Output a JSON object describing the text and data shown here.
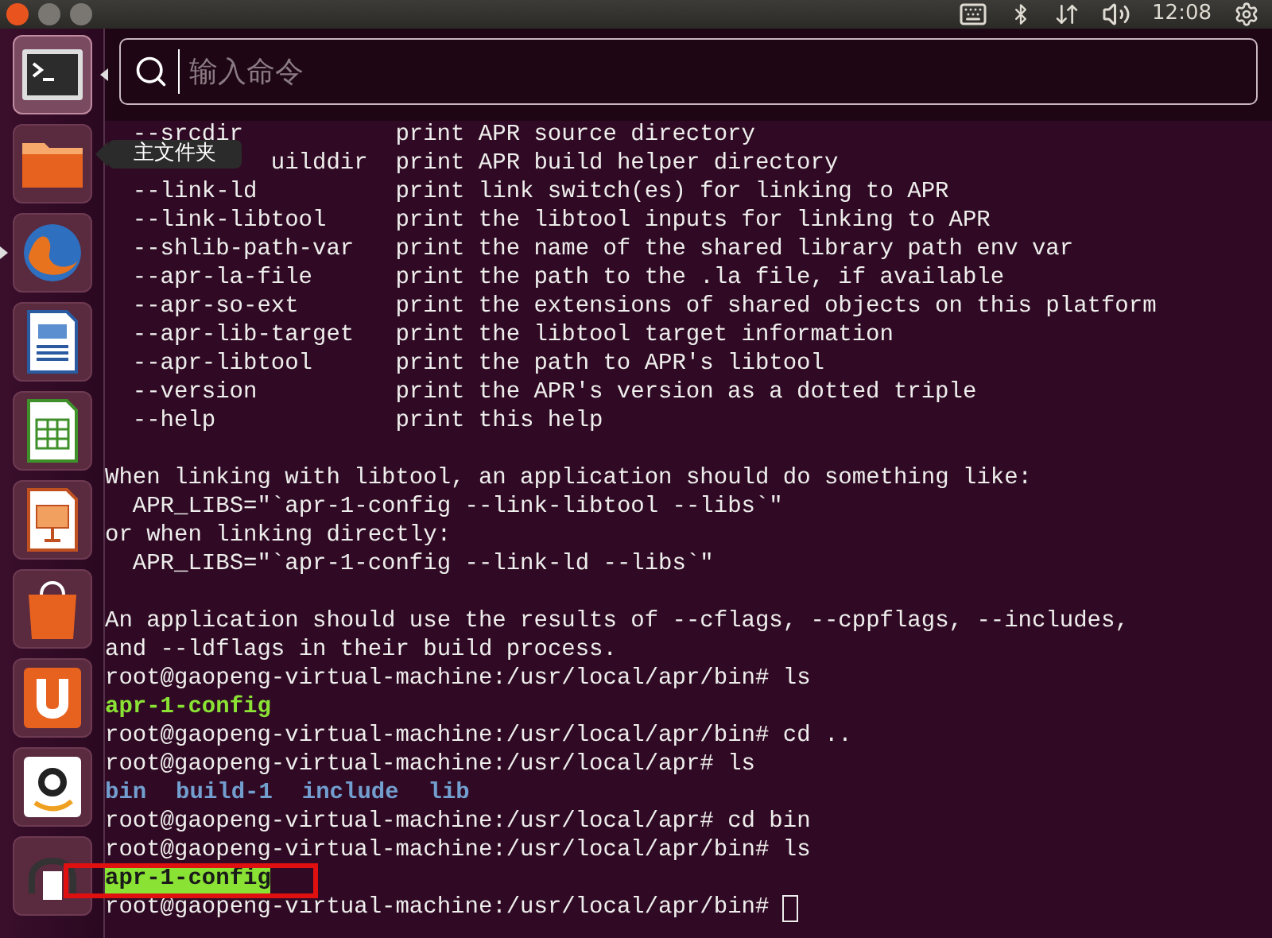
{
  "top_panel": {
    "clock": "12:08"
  },
  "dash": {
    "search": {
      "placeholder": "输入命令"
    }
  },
  "launcher": {
    "items": [
      {
        "kind": "terminal",
        "focused": true,
        "running": false
      },
      {
        "kind": "folder",
        "focused": false,
        "running": false
      },
      {
        "kind": "browser",
        "focused": false,
        "running": true
      },
      {
        "kind": "writer",
        "focused": false,
        "running": false
      },
      {
        "kind": "calc",
        "focused": false,
        "running": false
      },
      {
        "kind": "impress",
        "focused": false,
        "running": false
      },
      {
        "kind": "store",
        "focused": false,
        "running": false
      },
      {
        "kind": "cloud",
        "focused": false,
        "running": false
      },
      {
        "kind": "amazon",
        "focused": false,
        "running": false
      },
      {
        "kind": "music",
        "focused": false,
        "running": false
      }
    ],
    "tooltip": "主文件夹"
  },
  "terminal": {
    "options": [
      {
        "option": "--srcdir",
        "description": "print APR source directory"
      },
      {
        "option": "uilddir",
        "kind": "partial",
        "description": "print APR build helper directory"
      },
      {
        "option": "--link-ld",
        "description": "print link switch(es) for linking to APR"
      },
      {
        "option": "--link-libtool",
        "description": "print the libtool inputs for linking to APR"
      },
      {
        "option": "--shlib-path-var",
        "description": "print the name of the shared library path env var"
      },
      {
        "option": "--apr-la-file",
        "description": "print the path to the .la file, if available"
      },
      {
        "option": "--apr-so-ext",
        "description": "print the extensions of shared objects on this platform"
      },
      {
        "option": "--apr-lib-target",
        "description": "print the libtool target information"
      },
      {
        "option": "--apr-libtool",
        "description": "print the path to APR's libtool"
      },
      {
        "option": "--version",
        "description": "print the APR's version as a dotted triple"
      },
      {
        "option": "--help",
        "description": "print this help"
      }
    ],
    "lines": [
      {
        "kind": "blank"
      },
      {
        "kind": "text",
        "text": "When linking with libtool, an application should do something like:"
      },
      {
        "kind": "text",
        "text": "  APR_LIBS=\"`apr-1-config --link-libtool --libs`\""
      },
      {
        "kind": "text",
        "text": "or when linking directly:"
      },
      {
        "kind": "text",
        "text": "  APR_LIBS=\"`apr-1-config --link-ld --libs`\""
      },
      {
        "kind": "blank"
      },
      {
        "kind": "text",
        "text": "An application should use the results of --cflags, --cppflags, --includes,"
      },
      {
        "kind": "text",
        "text": "and --ldflags in their build process."
      },
      {
        "kind": "text",
        "text": "root@gaopeng-virtual-machine:/usr/local/apr/bin# ls"
      },
      {
        "kind": "listing",
        "entries": [
          {
            "name": "apr-1-config",
            "color": "#8ae234"
          }
        ]
      },
      {
        "kind": "text",
        "text": "root@gaopeng-virtual-machine:/usr/local/apr/bin# cd .."
      },
      {
        "kind": "text",
        "text": "root@gaopeng-virtual-machine:/usr/local/apr# ls"
      },
      {
        "kind": "listing",
        "entries": [
          {
            "name": "bin",
            "color": "#729fcf"
          },
          {
            "name": "build-1",
            "color": "#729fcf"
          },
          {
            "name": "include",
            "color": "#729fcf"
          },
          {
            "name": "lib",
            "color": "#729fcf"
          }
        ]
      },
      {
        "kind": "text",
        "text": "root@gaopeng-virtual-machine:/usr/local/apr# cd bin"
      },
      {
        "kind": "text",
        "text": "root@gaopeng-virtual-machine:/usr/local/apr/bin# ls"
      },
      {
        "kind": "listing",
        "marked": true,
        "entries": [
          {
            "name": "apr-1-config",
            "color": "#8ae234",
            "selected": true
          }
        ]
      },
      {
        "kind": "prompt",
        "text": "root@gaopeng-virtual-machine:/usr/local/apr/bin# "
      }
    ]
  }
}
